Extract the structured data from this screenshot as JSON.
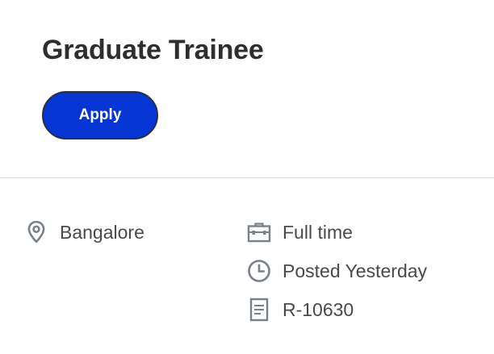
{
  "job": {
    "title": "Graduate Trainee",
    "apply_label": "Apply"
  },
  "details": {
    "location": {
      "icon": "location-pin-icon",
      "text": "Bangalore"
    },
    "time_type": {
      "icon": "briefcase-icon",
      "text": "Full time"
    },
    "posted": {
      "icon": "clock-icon",
      "text": "Posted Yesterday"
    },
    "requisition": {
      "icon": "document-icon",
      "text": "R-10630"
    }
  },
  "colors": {
    "apply_button": "#0535d2",
    "icon": "#7a8087",
    "title": "#2e2e2e"
  }
}
